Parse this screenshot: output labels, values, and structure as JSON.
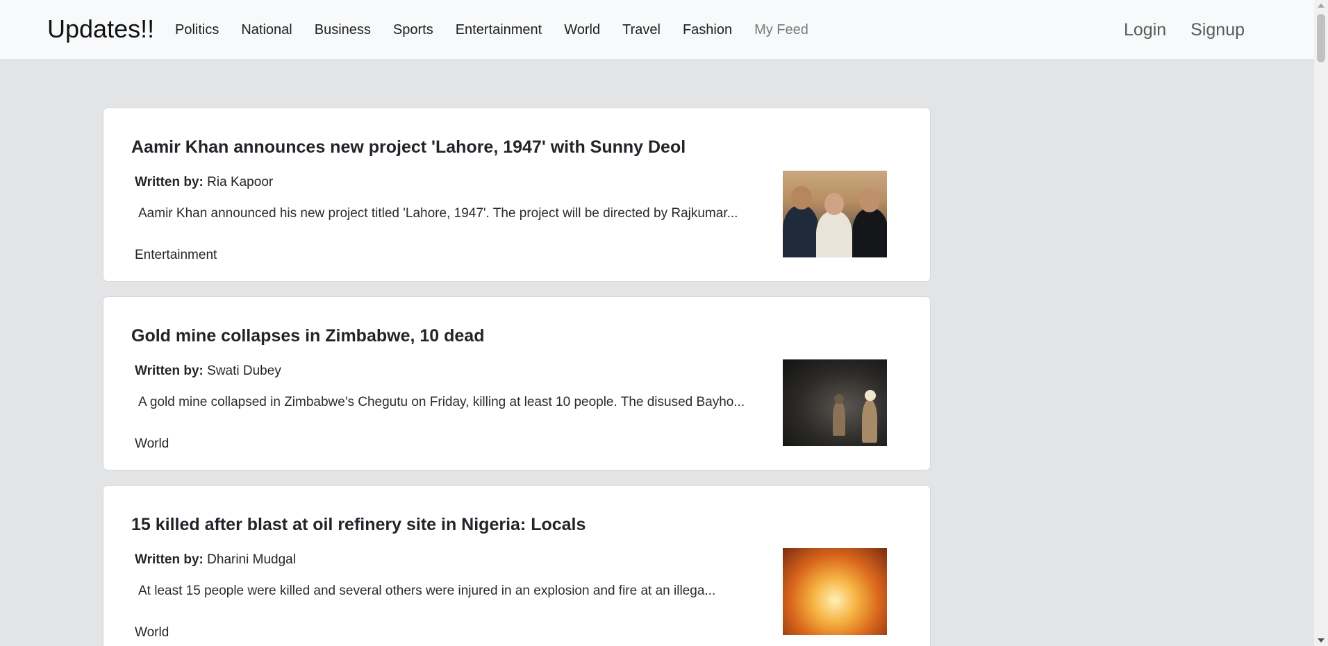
{
  "navbar": {
    "brand": "Updates!!",
    "links": [
      "Politics",
      "National",
      "Business",
      "Sports",
      "Entertainment",
      "World",
      "Travel",
      "Fashion"
    ],
    "muted_link": "My Feed",
    "login": "Login",
    "signup": "Signup"
  },
  "articles": [
    {
      "title": "Aamir Khan announces new project 'Lahore, 1947' with Sunny Deol",
      "author_label": "Written by:",
      "author": "Ria Kapoor",
      "excerpt": "Aamir Khan announced his new project titled 'Lahore, 1947'. The project will be directed by Rajkumar...",
      "category": "Entertainment",
      "image": "people-photo"
    },
    {
      "title": "Gold mine collapses in Zimbabwe, 10 dead",
      "author_label": "Written by:",
      "author": "Swati Dubey",
      "excerpt": "A gold mine collapsed in Zimbabwe's Chegutu on Friday, killing at least 10 people. The disused Bayho...",
      "category": "World",
      "image": "mine-photo"
    },
    {
      "title": "15 killed after blast at oil refinery site in Nigeria: Locals",
      "author_label": "Written by:",
      "author": "Dharini Mudgal",
      "excerpt": "At least 15 people were killed and several others were injured in an explosion and fire at an illega...",
      "category": "World",
      "image": "fire-photo"
    }
  ]
}
